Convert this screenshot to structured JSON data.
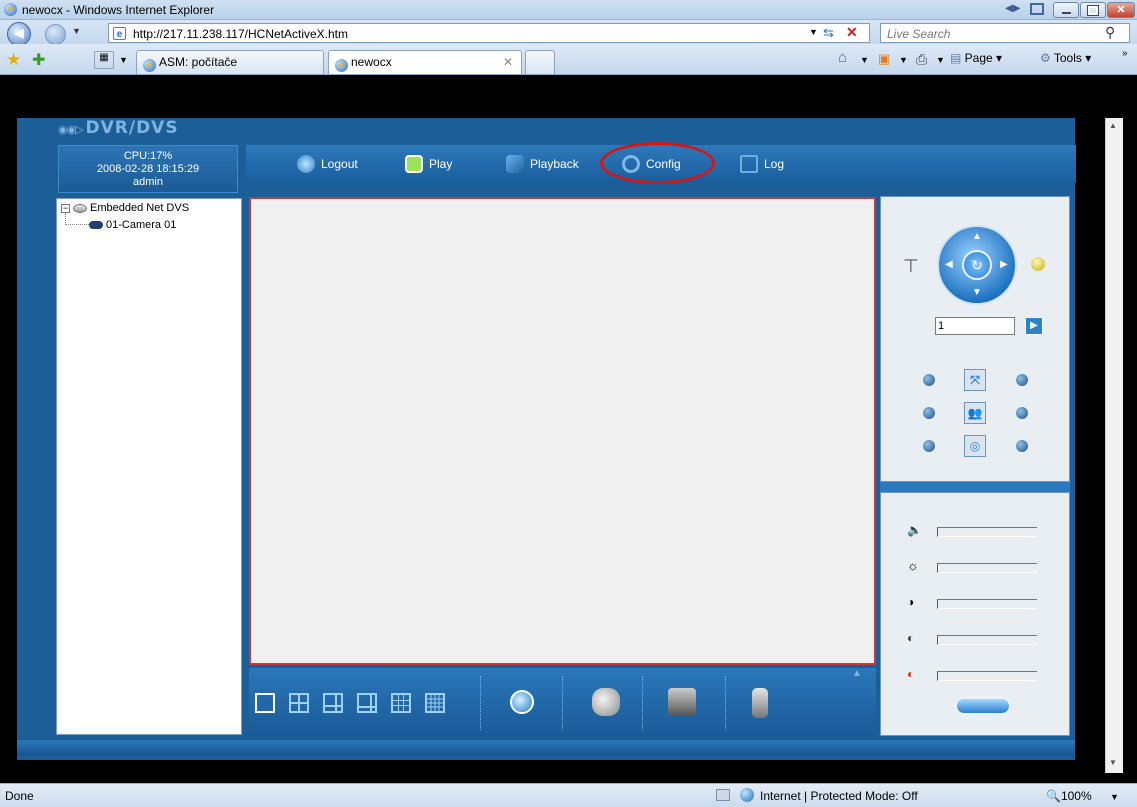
{
  "window": {
    "title": "newocx - Windows Internet Explorer"
  },
  "address": {
    "url": "http://217.11.238.117/HCNetActiveX.htm",
    "search_placeholder": "Live Search"
  },
  "tabs": [
    {
      "label": "ASM: počítače"
    },
    {
      "label": "newocx"
    }
  ],
  "toolbar": {
    "page_label": "Page",
    "tools_label": "Tools"
  },
  "app": {
    "brand": "DVR/DVS",
    "cpu": "CPU:17%",
    "datetime": "2008-02-28 18:15:29",
    "user": "admin",
    "menu": [
      {
        "label": "Logout"
      },
      {
        "label": "Play"
      },
      {
        "label": "Playback"
      },
      {
        "label": "Config"
      },
      {
        "label": "Log"
      }
    ],
    "tree": {
      "root": "Embedded Net DVS",
      "camera": "01-Camera 01"
    },
    "ptz": {
      "preset_value": "1"
    }
  },
  "status": {
    "left": "Done",
    "zone": "Internet | Protected Mode: Off",
    "zoom": "100%"
  },
  "colors": {
    "app_blue": "#1c5f98",
    "highlight_red": "#d01818"
  }
}
